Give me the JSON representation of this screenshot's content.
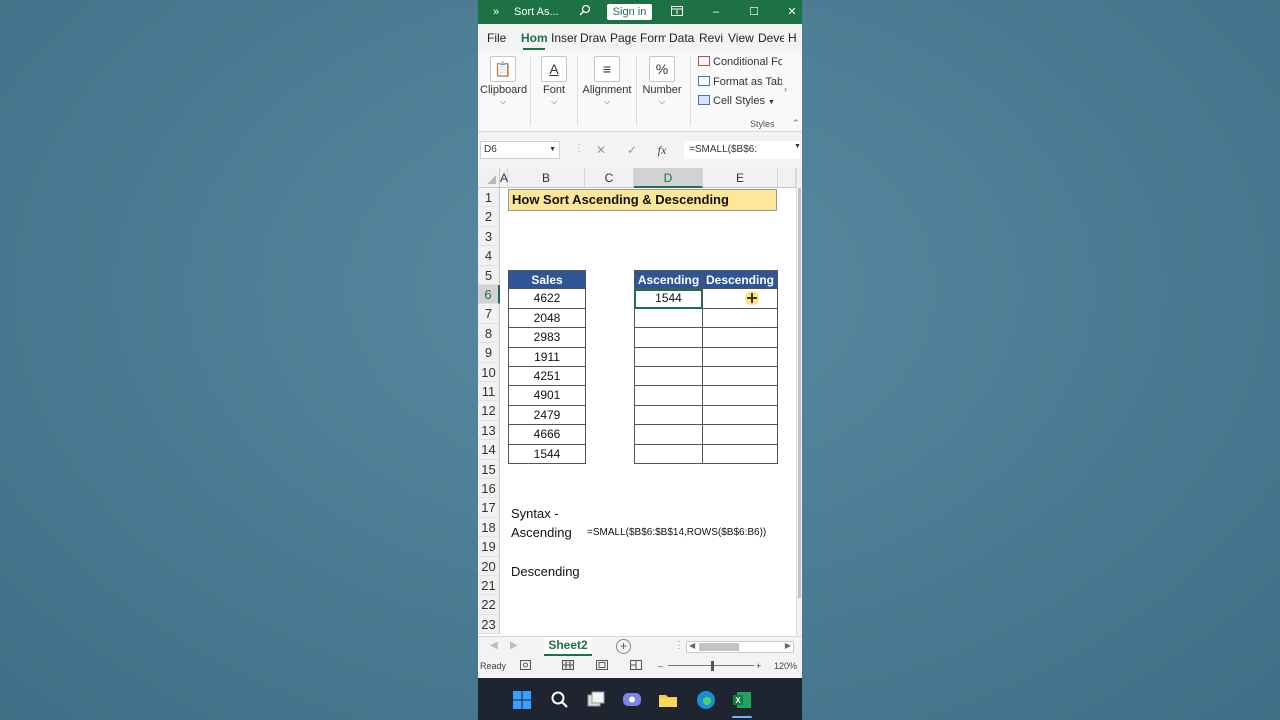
{
  "window": {
    "title": "Sort As...",
    "overflow_label": "»",
    "signin_label": "Sign in",
    "minimize_label": "–",
    "maximize_label": "☐",
    "close_label": "✕"
  },
  "ribbon_tabs": [
    "File",
    "Hom",
    "Inser",
    "Draw",
    "Page",
    "Form",
    "Data",
    "Revi",
    "View",
    "Deve",
    "H"
  ],
  "ribbon": {
    "groups": [
      {
        "label": "Clipboard",
        "icon": "clipboard-icon",
        "glyph": "📋"
      },
      {
        "label": "Font",
        "icon": "font-icon",
        "glyph": "A"
      },
      {
        "label": "Alignment",
        "icon": "alignment-icon",
        "glyph": "≡"
      },
      {
        "label": "Number",
        "icon": "percent-icon",
        "glyph": "%"
      }
    ],
    "styles": [
      "Conditional For",
      "Format as Table",
      "Cell Styles"
    ],
    "styles_group_label": "Styles",
    "chevron": "⌵"
  },
  "formula_bar": {
    "name_box": "D6",
    "formula": "=SMALL($B$6:",
    "cancel_glyph": "✕",
    "enter_glyph": "✓",
    "fx_glyph": "fx"
  },
  "grid": {
    "columns": [
      "A",
      "B",
      "C",
      "D",
      "E"
    ],
    "rows": [
      "1",
      "2",
      "3",
      "4",
      "5",
      "6",
      "7",
      "8",
      "9",
      "10",
      "11",
      "12",
      "13",
      "14",
      "15",
      "16",
      "17",
      "18",
      "19",
      "20",
      "21",
      "22",
      "23"
    ],
    "selected_column": "D",
    "selected_row": "6"
  },
  "sheet": {
    "title": "How Sort Ascending & Descending",
    "sales_header": "Sales",
    "sales": [
      "4622",
      "2048",
      "2983",
      "1911",
      "4251",
      "4901",
      "2479",
      "4666",
      "1544"
    ],
    "ascending_header": "Ascending",
    "descending_header": "Descending",
    "ascending": [
      "1544",
      "",
      "",
      "",
      "",
      "",
      "",
      "",
      ""
    ],
    "descending": [
      "",
      "",
      "",
      "",
      "",
      "",
      "",
      "",
      ""
    ],
    "syntax_label": "Syntax -",
    "ascending_label": "Ascending",
    "ascending_formula": "=SMALL($B$6:$B$14,ROWS($B$6:B6))",
    "descending_label": "Descending"
  },
  "sheet_tabs": {
    "active": "Sheet2",
    "add_glyph": "+"
  },
  "status": {
    "ready": "Ready",
    "zoom": "120%",
    "zoom_minus": "–",
    "zoom_plus": "+"
  },
  "colors": {
    "excel_green": "#1e7145",
    "header_blue": "#2f5597",
    "title_fill": "#ffe699"
  }
}
